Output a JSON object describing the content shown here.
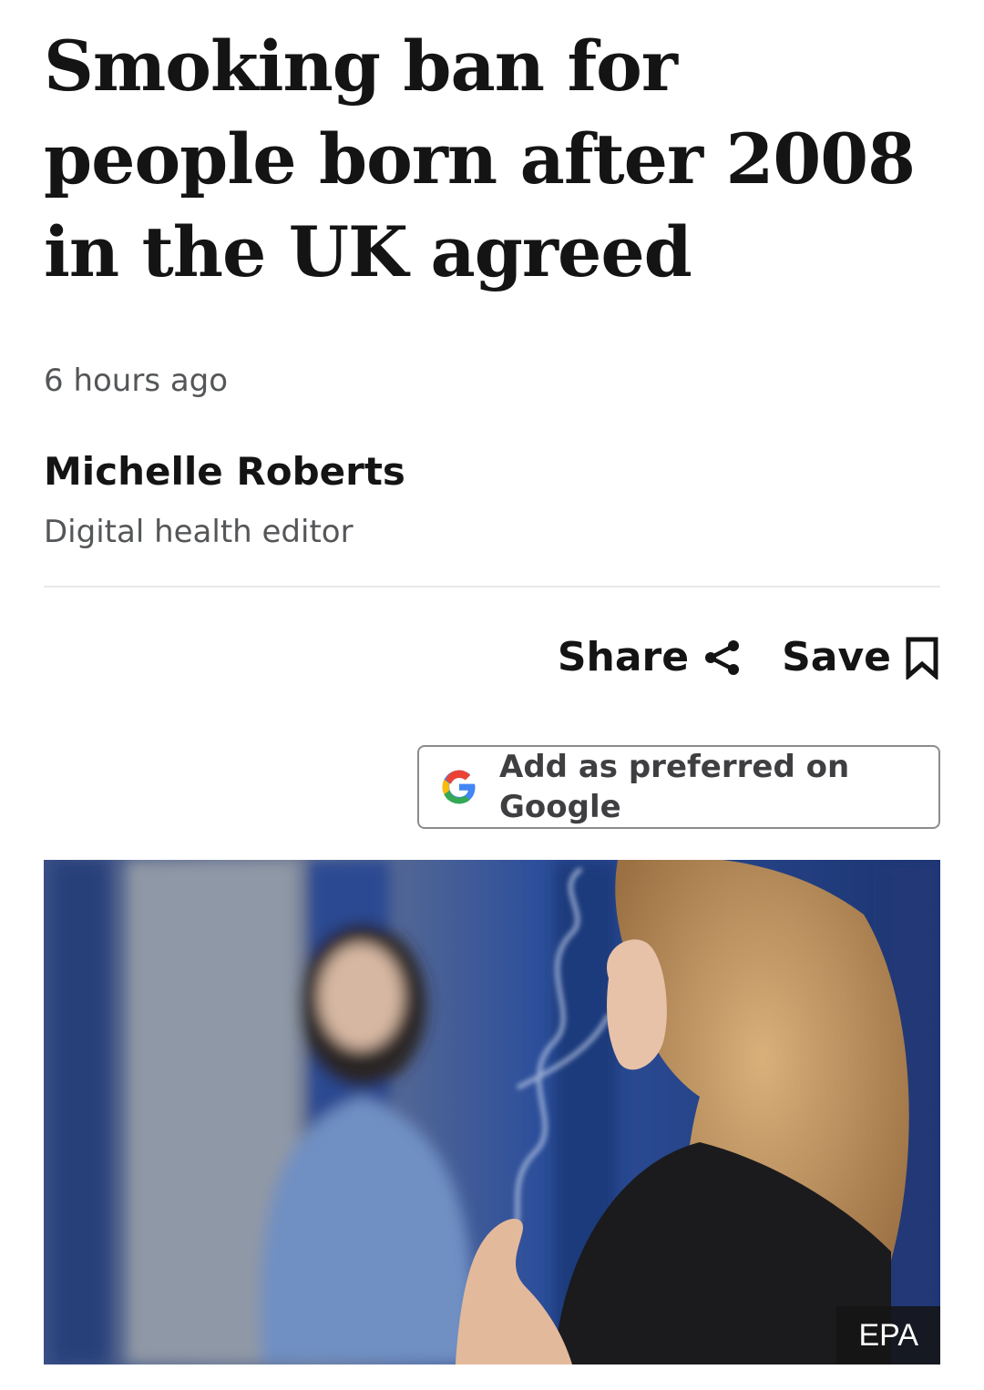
{
  "article": {
    "headline": "Smoking ban for people born after 2008 in the UK agreed",
    "timestamp": "6 hours ago",
    "byline": {
      "name": "Michelle Roberts",
      "role": "Digital health editor"
    }
  },
  "actions": {
    "share_label": "Share",
    "share_icon": "share-icon",
    "save_label": "Save",
    "save_icon": "bookmark-icon"
  },
  "google_button": {
    "label": "Add as preferred on Google",
    "icon": "google-g-icon"
  },
  "hero_image": {
    "credit": "EPA"
  },
  "colors": {
    "text_primary": "#141414",
    "text_secondary": "#545658",
    "divider": "#e6e8ea",
    "button_border": "#8a8c8e"
  }
}
